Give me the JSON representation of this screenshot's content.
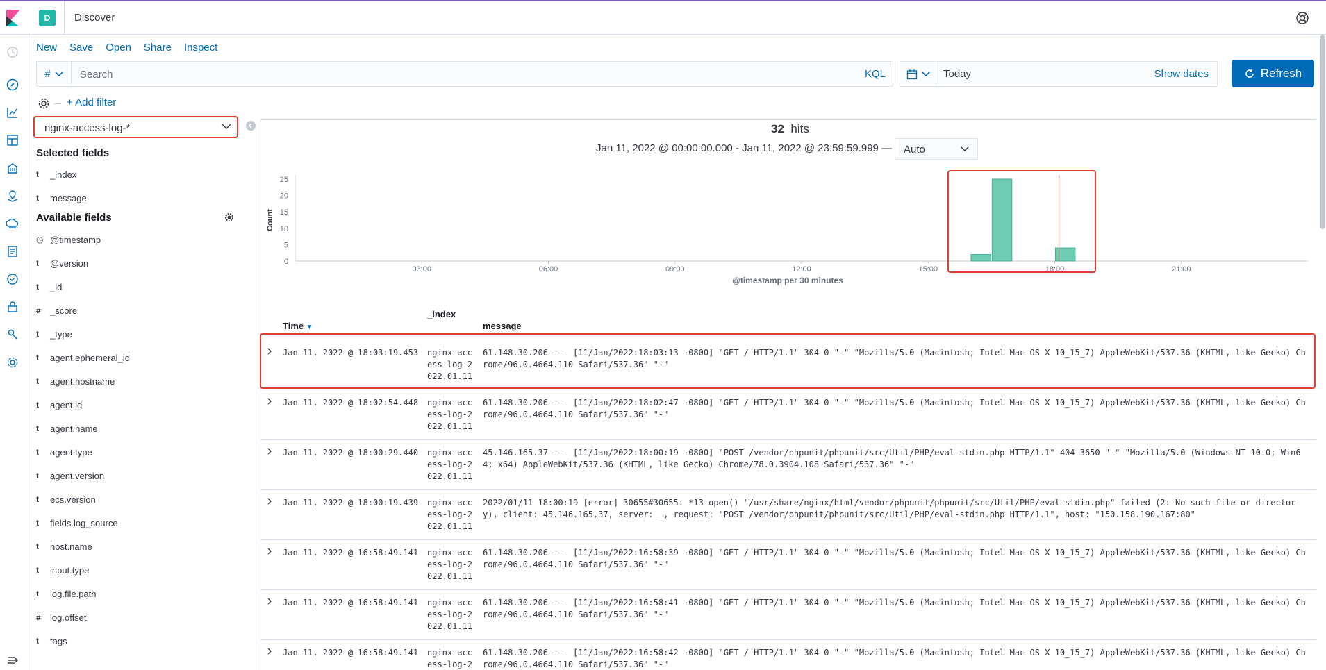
{
  "header": {
    "title": "Discover",
    "space_initial": "D"
  },
  "menu": {
    "new": "New",
    "save": "Save",
    "open": "Open",
    "share": "Share",
    "inspect": "Inspect"
  },
  "query": {
    "lang_symbol": "#",
    "placeholder": "Search",
    "kql": "KQL"
  },
  "date": {
    "value": "Today",
    "show_dates": "Show dates"
  },
  "refresh_label": "Refresh",
  "filter": {
    "add_filter": "+ Add filter"
  },
  "sidebar": {
    "index_pattern": "nginx-access-log-*",
    "selected_heading": "Selected fields",
    "selected_fields": [
      {
        "type": "t",
        "name": "_index"
      },
      {
        "type": "t",
        "name": "message"
      }
    ],
    "available_heading": "Available fields",
    "available_fields": [
      {
        "type": "◷",
        "name": "@timestamp"
      },
      {
        "type": "t",
        "name": "@version"
      },
      {
        "type": "t",
        "name": "_id"
      },
      {
        "type": "#",
        "name": "_score"
      },
      {
        "type": "t",
        "name": "_type"
      },
      {
        "type": "t",
        "name": "agent.ephemeral_id"
      },
      {
        "type": "t",
        "name": "agent.hostname"
      },
      {
        "type": "t",
        "name": "agent.id"
      },
      {
        "type": "t",
        "name": "agent.name"
      },
      {
        "type": "t",
        "name": "agent.type"
      },
      {
        "type": "t",
        "name": "agent.version"
      },
      {
        "type": "t",
        "name": "ecs.version"
      },
      {
        "type": "t",
        "name": "fields.log_source"
      },
      {
        "type": "t",
        "name": "host.name"
      },
      {
        "type": "t",
        "name": "input.type"
      },
      {
        "type": "t",
        "name": "log.file.path"
      },
      {
        "type": "#",
        "name": "log.offset"
      },
      {
        "type": "t",
        "name": "tags"
      }
    ]
  },
  "results": {
    "hits_count": "32",
    "hits_label": "hits",
    "range": "Jan 11, 2022 @ 00:00:00.000 - Jan 11, 2022 @ 23:59:59.999 —",
    "interval": "Auto"
  },
  "chart_data": {
    "type": "bar",
    "title": "",
    "xlabel": "@timestamp per 30 minutes",
    "ylabel": "Count",
    "ylim": [
      0,
      25
    ],
    "y_ticks": [
      0,
      5,
      10,
      15,
      20,
      25
    ],
    "x_range_hours": [
      0,
      24
    ],
    "x_ticks": [
      {
        "hour": 3,
        "label": "03:00"
      },
      {
        "hour": 6,
        "label": "06:00"
      },
      {
        "hour": 9,
        "label": "09:00"
      },
      {
        "hour": 12,
        "label": "12:00"
      },
      {
        "hour": 15,
        "label": "15:00"
      },
      {
        "hour": 18,
        "label": "18:00"
      },
      {
        "hour": 21,
        "label": "21:00"
      }
    ],
    "bars": [
      {
        "start_hour": 16.0,
        "value": 2
      },
      {
        "start_hour": 16.5,
        "value": 26
      },
      {
        "start_hour": 18.0,
        "value": 4
      }
    ],
    "now_marker_hour": 18.1,
    "bar_color": "#6dccb1",
    "marker_color": "#e7664c"
  },
  "table": {
    "headers": {
      "time": "Time",
      "index": "_index",
      "message": "message"
    },
    "rows": [
      {
        "time": "Jan 11, 2022 @ 18:03:19.453",
        "index": "nginx-access-log-2022.01.11",
        "message": "61.148.30.206 - - [11/Jan/2022:18:03:13 +0800] \"GET / HTTP/1.1\" 304 0 \"-\" \"Mozilla/5.0 (Macintosh; Intel Mac OS X 10_15_7) AppleWebKit/537.36 (KHTML, like Gecko) Chrome/96.0.4664.110 Safari/537.36\" \"-\""
      },
      {
        "time": "Jan 11, 2022 @ 18:02:54.448",
        "index": "nginx-access-log-2022.01.11",
        "message": "61.148.30.206 - - [11/Jan/2022:18:02:47 +0800] \"GET / HTTP/1.1\" 304 0 \"-\" \"Mozilla/5.0 (Macintosh; Intel Mac OS X 10_15_7) AppleWebKit/537.36 (KHTML, like Gecko) Chrome/96.0.4664.110 Safari/537.36\" \"-\""
      },
      {
        "time": "Jan 11, 2022 @ 18:00:29.440",
        "index": "nginx-access-log-2022.01.11",
        "message": "45.146.165.37 - - [11/Jan/2022:18:00:19 +0800] \"POST /vendor/phpunit/phpunit/src/Util/PHP/eval-stdin.php HTTP/1.1\" 404 3650 \"-\" \"Mozilla/5.0 (Windows NT 10.0; Win64; x64) AppleWebKit/537.36 (KHTML, like Gecko) Chrome/78.0.3904.108 Safari/537.36\" \"-\""
      },
      {
        "time": "Jan 11, 2022 @ 18:00:19.439",
        "index": "nginx-access-log-2022.01.11",
        "message": "2022/01/11 18:00:19 [error] 30655#30655: *13 open() \"/usr/share/nginx/html/vendor/phpunit/phpunit/src/Util/PHP/eval-stdin.php\" failed (2: No such file or directory), client: 45.146.165.37, server: _, request: \"POST /vendor/phpunit/phpunit/src/Util/PHP/eval-stdin.php HTTP/1.1\", host: \"150.158.190.167:80\""
      },
      {
        "time": "Jan 11, 2022 @ 16:58:49.141",
        "index": "nginx-access-log-2022.01.11",
        "message": "61.148.30.206 - - [11/Jan/2022:16:58:39 +0800] \"GET / HTTP/1.1\" 304 0 \"-\" \"Mozilla/5.0 (Macintosh; Intel Mac OS X 10_15_7) AppleWebKit/537.36 (KHTML, like Gecko) Chrome/96.0.4664.110 Safari/537.36\" \"-\""
      },
      {
        "time": "Jan 11, 2022 @ 16:58:49.141",
        "index": "nginx-access-log-2022.01.11",
        "message": "61.148.30.206 - - [11/Jan/2022:16:58:41 +0800] \"GET / HTTP/1.1\" 304 0 \"-\" \"Mozilla/5.0 (Macintosh; Intel Mac OS X 10_15_7) AppleWebKit/537.36 (KHTML, like Gecko) Chrome/96.0.4664.110 Safari/537.36\" \"-\""
      },
      {
        "time": "Jan 11, 2022 @ 16:58:49.141",
        "index": "nginx-access-log-2",
        "message": "61.148.30.206 - - [11/Jan/2022:16:58:42 +0800] \"GET / HTTP/1.1\" 304 0 \"-\" \"Mozilla/5.0 (Macintosh; Intel Mac OS X 10_15_7) AppleWebKit/537.36 (KHTML, like Gecko) Chrome/96.0.4664.110 Safari/537.36\" \"-\""
      }
    ]
  },
  "colors": {
    "accent": "#006bb8",
    "highlight": "#e23c2e",
    "space": "#20b8a7"
  }
}
